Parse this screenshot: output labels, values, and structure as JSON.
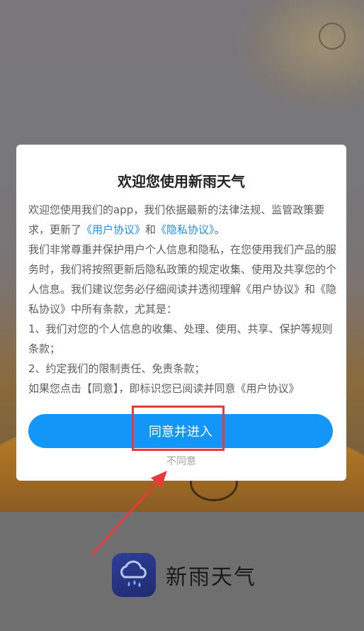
{
  "dialog": {
    "title": "欢迎您使用新雨天气",
    "intro": {
      "text_before": "欢迎您使用我们的app，我们依据最新的法律法规、监管政策要求，更新了",
      "link1": "《用户协议》",
      "and": "和",
      "link2": "《隐私协议》",
      "text_after": "。"
    },
    "paragraph2": "我们非常尊重并保护用户个人信息和隐私，在您使用我们产品的服务时，我们将按照更新后隐私政策的规定收集、使用及共享您的个人信息。我们建议您务必仔细阅读并透彻理解《用户协议》和《隐私协议》中所有条款，尤其是：",
    "item1": "1、我们对您的个人信息的收集、处理、使用、共享、保护等规则条款；",
    "item2": "2、约定我们的限制责任、免责条款；",
    "paragraph3": "如果您点击【同意】，即标识您已阅读并同意《用户协议》",
    "agree_label": "同意并进入",
    "disagree_label": "不同意"
  },
  "splash": {
    "app_name": "新雨天气",
    "app_icon": "cloud-rain-icon"
  },
  "colors": {
    "accent": "#1296f7",
    "link": "#1b8ef0",
    "annotation": "#e8393b",
    "app_icon_bg": "#25327f"
  }
}
